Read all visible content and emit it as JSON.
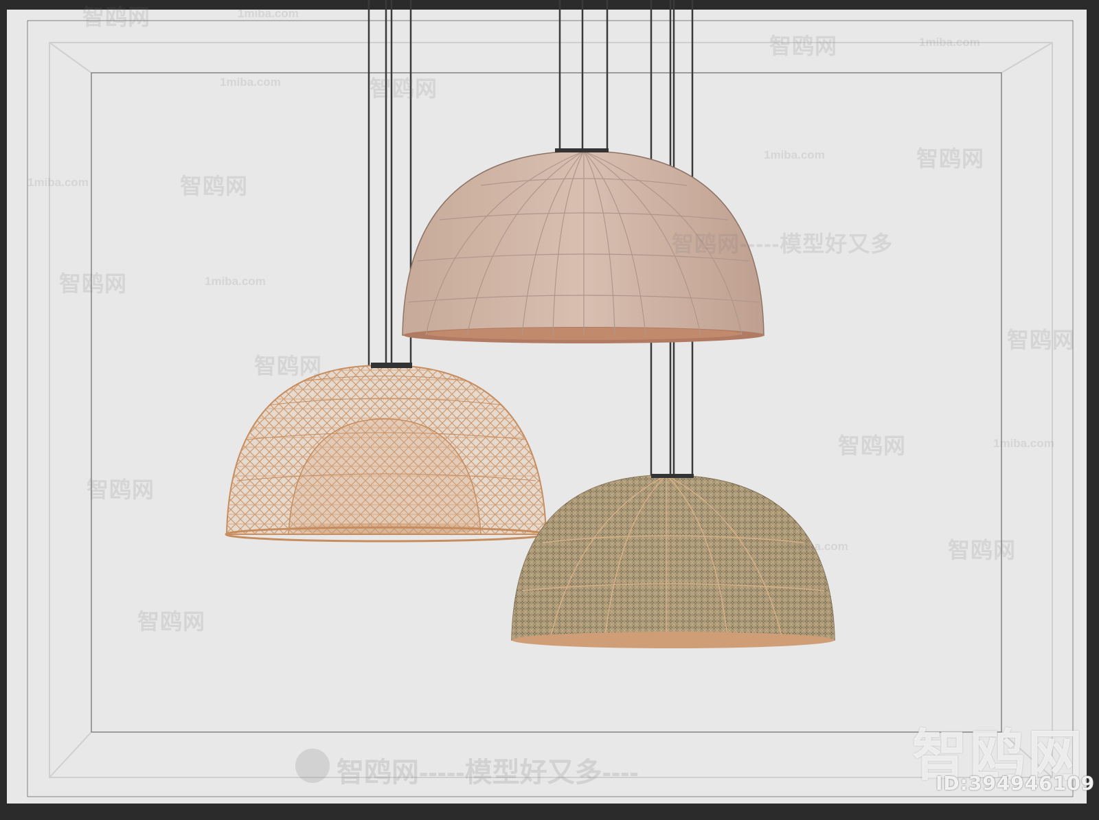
{
  "scene": {
    "background": "#e9e8e8",
    "border_color": "#2b2b2b"
  },
  "watermarks": {
    "domain": "1miba.com",
    "brand": "智鸥网",
    "slogan": "智鸥网-----模型好又多",
    "footer": "智鸥网-----模型好又多----",
    "corner_brand": "智鸥网",
    "id_label": "ID:394946109"
  },
  "lamps": [
    {
      "name": "top-fabric-dome",
      "color": "#d3b8a8"
    },
    {
      "name": "left-rattan-dome",
      "color": "#d9a77e"
    },
    {
      "name": "right-cane-dome",
      "color": "#9a8a6e"
    }
  ]
}
